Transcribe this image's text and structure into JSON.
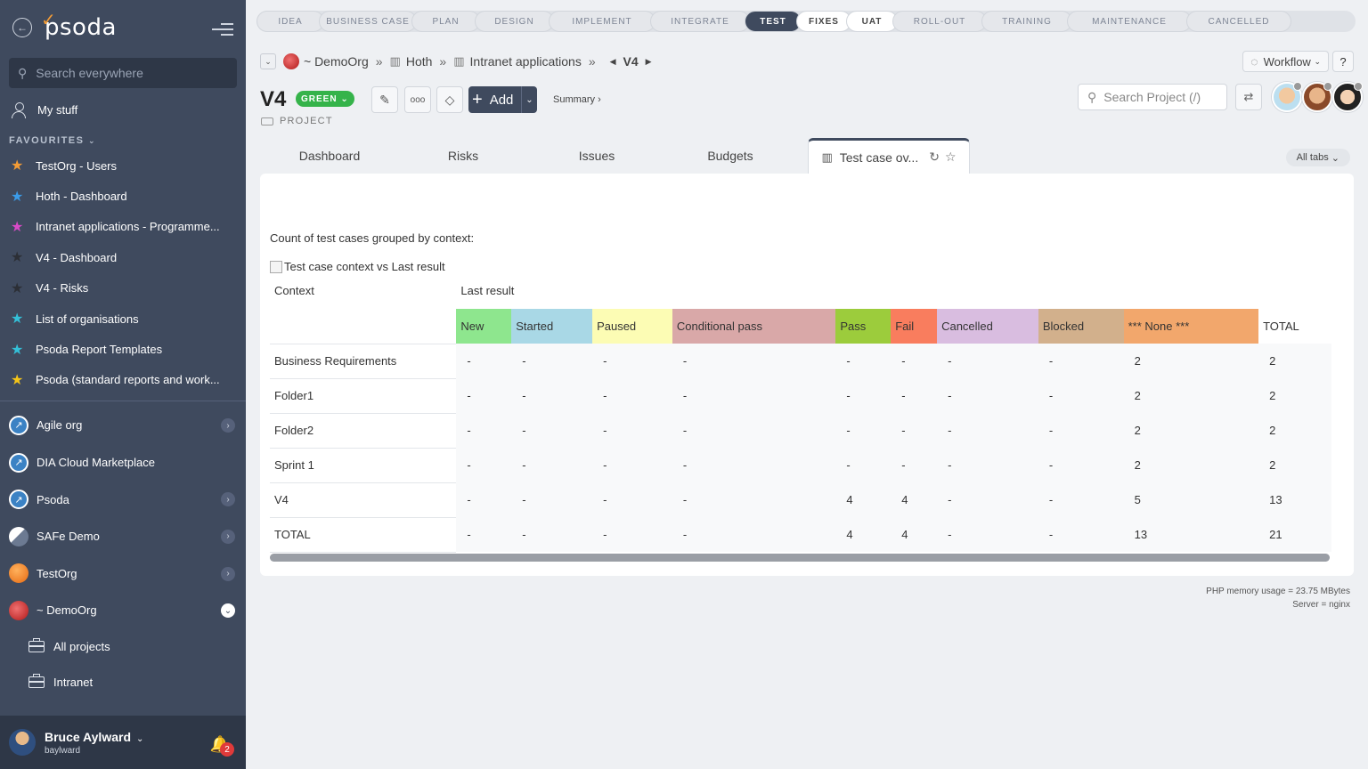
{
  "sidebar": {
    "logo": "psoda",
    "search_placeholder": "Search everywhere",
    "my_stuff": "My stuff",
    "favourites_label": "FAVOURITES",
    "favourites": [
      {
        "label": "TestOrg - Users",
        "color": "#f39c36"
      },
      {
        "label": "Hoth - Dashboard",
        "color": "#3b9be8"
      },
      {
        "label": "Intranet applications - Programme...",
        "color": "#d84ac7"
      },
      {
        "label": "V4 - Dashboard",
        "color": "#2c2f36"
      },
      {
        "label": "V4 - Risks",
        "color": "#2c2f36"
      },
      {
        "label": "List of organisations",
        "color": "#34c0d8"
      },
      {
        "label": "Psoda Report Templates",
        "color": "#34c0d8"
      },
      {
        "label": "Psoda (standard reports and work...",
        "color": "#f5c518"
      }
    ],
    "orgs": [
      {
        "label": "Agile org",
        "chevron": true
      },
      {
        "label": "DIA Cloud Marketplace",
        "chevron": false
      },
      {
        "label": "Psoda",
        "chevron": true
      },
      {
        "label": "SAFe Demo",
        "chevron": true
      },
      {
        "label": "TestOrg",
        "chevron": true
      },
      {
        "label": "~ DemoOrg",
        "chevron": true
      }
    ],
    "sub_items": [
      "All projects",
      "Intranet"
    ],
    "user": {
      "name": "Bruce Aylward",
      "login": "baylward",
      "notifications": "2"
    }
  },
  "stages": [
    "IDEA",
    "BUSINESS CASE",
    "PLAN",
    "DESIGN",
    "IMPLEMENT",
    "INTEGRATE",
    "TEST",
    "FIXES",
    "UAT",
    "ROLL-OUT",
    "TRAINING",
    "MAINTENANCE",
    "CANCELLED"
  ],
  "breadcrumb": {
    "org": "~ DemoOrg",
    "programme": "Hoth",
    "project_group": "Intranet applications",
    "current": "V4"
  },
  "workflow_label": "Workflow",
  "help_label": "?",
  "project": {
    "title": "V4",
    "status": "GREEN",
    "type": "PROJECT"
  },
  "add_label": "Add",
  "summary_label": "Summary ›",
  "search_project_placeholder": "Search Project (/)",
  "tabs": [
    "Dashboard",
    "Risks",
    "Issues",
    "Budgets",
    "Test case ov..."
  ],
  "all_tabs_label": "All tabs",
  "content": {
    "intro": "Count of test cases grouped by context:",
    "image_alt": "Test case context vs Last result",
    "context_header": "Context",
    "group_header": "Last result",
    "columns": [
      {
        "label": "New",
        "color": "#8ee68e"
      },
      {
        "label": "Started",
        "color": "#a9d8e6"
      },
      {
        "label": "Paused",
        "color": "#fcfcb4"
      },
      {
        "label": "Conditional pass",
        "color": "#d9a8a8"
      },
      {
        "label": "Pass",
        "color": "#9ccc3c"
      },
      {
        "label": "Fail",
        "color": "#f97d5e"
      },
      {
        "label": "Cancelled",
        "color": "#d9bde0"
      },
      {
        "label": "Blocked",
        "color": "#d2b08c"
      },
      {
        "label": "*** None ***",
        "color": "#f2a76c"
      },
      {
        "label": "TOTAL",
        "color": "#ffffff"
      }
    ],
    "rows": [
      {
        "context": "Business Requirements",
        "values": [
          "-",
          "-",
          "-",
          "-",
          "-",
          "-",
          "-",
          "-",
          "2",
          "2"
        ]
      },
      {
        "context": "Folder1",
        "values": [
          "-",
          "-",
          "-",
          "-",
          "-",
          "-",
          "-",
          "-",
          "2",
          "2"
        ]
      },
      {
        "context": "Folder2",
        "values": [
          "-",
          "-",
          "-",
          "-",
          "-",
          "-",
          "-",
          "-",
          "2",
          "2"
        ]
      },
      {
        "context": "Sprint 1",
        "values": [
          "-",
          "-",
          "-",
          "-",
          "-",
          "-",
          "-",
          "-",
          "2",
          "2"
        ]
      },
      {
        "context": "V4",
        "values": [
          "-",
          "-",
          "-",
          "-",
          "4",
          "4",
          "-",
          "-",
          "5",
          "13"
        ]
      },
      {
        "context": "TOTAL",
        "values": [
          "-",
          "-",
          "-",
          "-",
          "4",
          "4",
          "-",
          "-",
          "13",
          "21"
        ]
      }
    ]
  },
  "footer": {
    "memory": "PHP memory usage = 23.75 MBytes",
    "server": "Server = nginx"
  }
}
